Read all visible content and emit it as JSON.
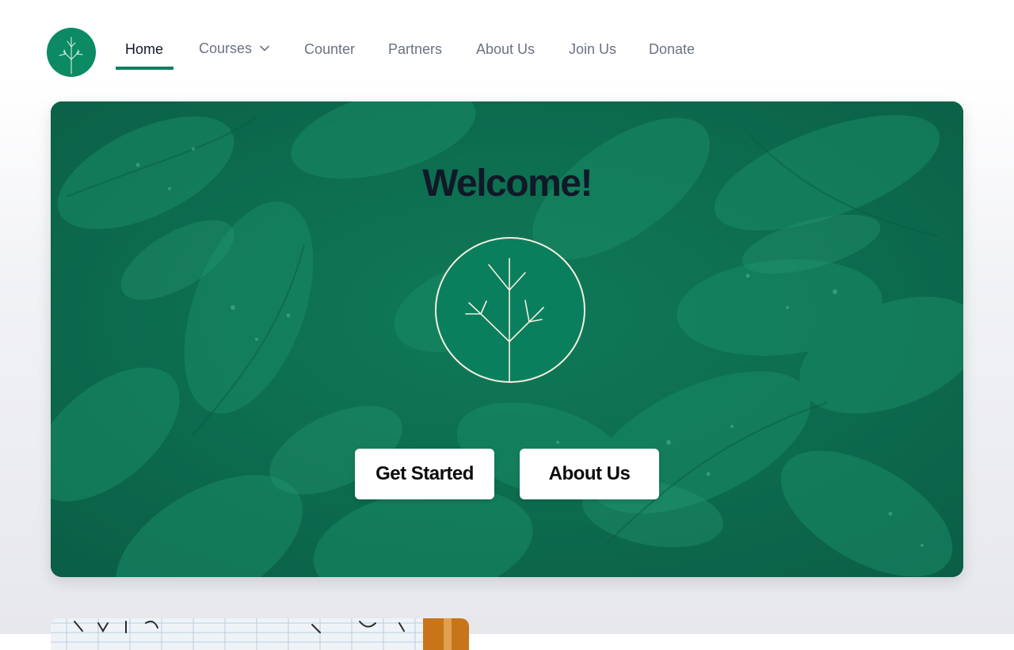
{
  "nav": {
    "logo_icon": "tree-logo-icon",
    "items": [
      {
        "label": "Home",
        "active": true
      },
      {
        "label": "Courses",
        "has_dropdown": true
      },
      {
        "label": "Counter"
      },
      {
        "label": "Partners"
      },
      {
        "label": "About Us"
      },
      {
        "label": "Join Us"
      },
      {
        "label": "Donate"
      }
    ],
    "chevron_icon": "chevron-down-icon"
  },
  "hero": {
    "title": "Welcome!",
    "emblem_icon": "tree-emblem-icon",
    "buttons": {
      "get_started": "Get Started",
      "about_us": "About Us"
    }
  },
  "colors": {
    "brand_green": "#0c8a63",
    "accent_underline": "#0c7f5f",
    "hero_overlay": "#0c6a4d",
    "nav_text": "#6b7280",
    "nav_active": "#111827",
    "button_bg": "#ffffff"
  }
}
